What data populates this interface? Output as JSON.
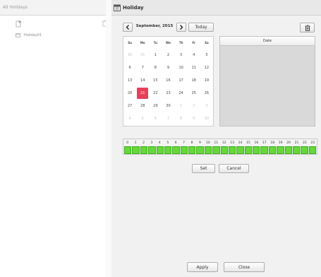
{
  "left_panel": {
    "title": "All Holidays",
    "items": [
      {
        "label": "Holiday01"
      }
    ]
  },
  "header": {
    "title": "Holiday"
  },
  "calendar": {
    "month_label": "September, 2015",
    "today_label": "Today",
    "weekdays": [
      "Su",
      "Mo",
      "Tu",
      "We",
      "Th",
      "Fr",
      "Sa"
    ],
    "days": [
      {
        "label": "30",
        "other": true
      },
      {
        "label": "31",
        "other": true
      },
      {
        "label": "1"
      },
      {
        "label": "2"
      },
      {
        "label": "3"
      },
      {
        "label": "4"
      },
      {
        "label": "5"
      },
      {
        "label": "6"
      },
      {
        "label": "7"
      },
      {
        "label": "8"
      },
      {
        "label": "9"
      },
      {
        "label": "10"
      },
      {
        "label": "11"
      },
      {
        "label": "12"
      },
      {
        "label": "13"
      },
      {
        "label": "14"
      },
      {
        "label": "15"
      },
      {
        "label": "16"
      },
      {
        "label": "17"
      },
      {
        "label": "18"
      },
      {
        "label": "19"
      },
      {
        "label": "20"
      },
      {
        "label": "21",
        "selected": true
      },
      {
        "label": "22"
      },
      {
        "label": "23"
      },
      {
        "label": "24"
      },
      {
        "label": "25"
      },
      {
        "label": "26"
      },
      {
        "label": "27"
      },
      {
        "label": "28"
      },
      {
        "label": "29"
      },
      {
        "label": "30"
      },
      {
        "label": "1",
        "other": true
      },
      {
        "label": "2",
        "other": true
      },
      {
        "label": "3",
        "other": true
      },
      {
        "label": "4",
        "other": true
      },
      {
        "label": "5",
        "other": true
      },
      {
        "label": "6",
        "other": true
      },
      {
        "label": "7",
        "other": true
      },
      {
        "label": "8",
        "other": true
      },
      {
        "label": "9",
        "other": true
      },
      {
        "label": "10",
        "other": true
      }
    ]
  },
  "date_table": {
    "header": "Date"
  },
  "hours": {
    "labels": [
      "0",
      "1",
      "2",
      "3",
      "4",
      "5",
      "6",
      "7",
      "8",
      "9",
      "10",
      "11",
      "12",
      "13",
      "14",
      "15",
      "16",
      "17",
      "18",
      "19",
      "20",
      "21",
      "22",
      "23"
    ],
    "active_color": "#66d83a"
  },
  "buttons": {
    "set": "Set",
    "cancel": "Cancel",
    "apply": "Apply",
    "close": "Close"
  },
  "colors": {
    "selected_day": "#e8405a",
    "active_hour": "#66d83a"
  },
  "icons": {
    "add": "add-icon",
    "delete": "trash-icon",
    "calendar": "calendar-icon",
    "prev": "chevron-left-icon",
    "next": "chevron-right-icon"
  }
}
